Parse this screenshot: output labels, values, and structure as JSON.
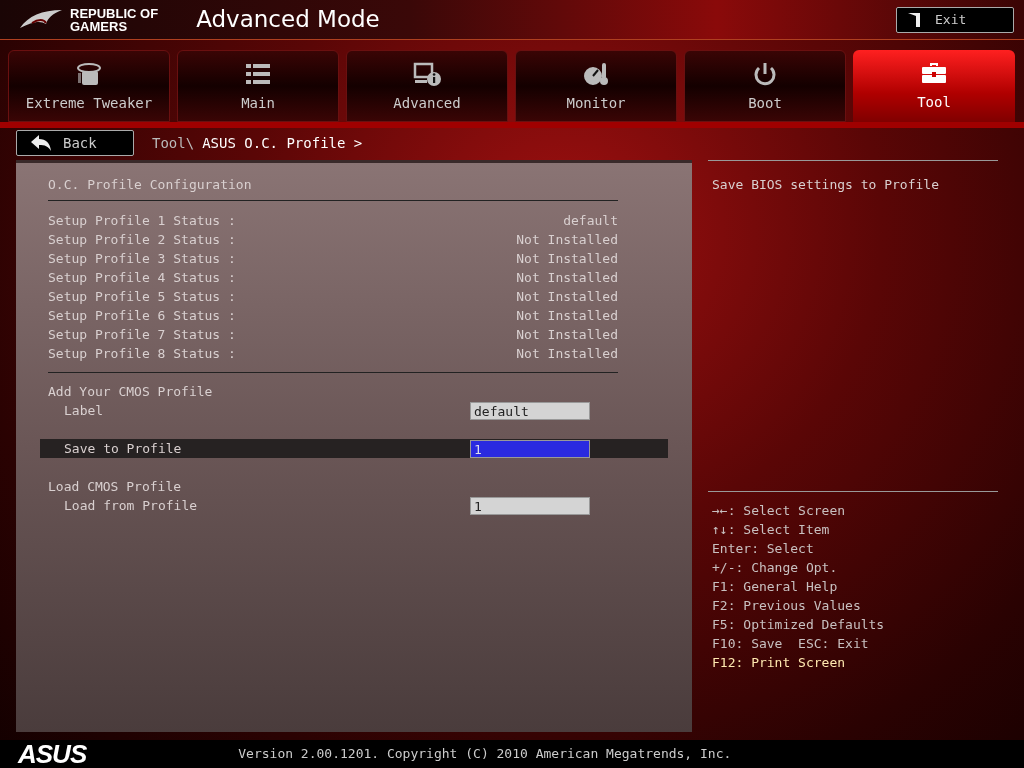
{
  "header": {
    "brand": [
      "REPUBLIC OF",
      "GAMERS"
    ],
    "title": "Advanced Mode",
    "exit_button": "Exit"
  },
  "tabs": [
    {
      "label": "Extreme Tweaker",
      "selected": false
    },
    {
      "label": "Main",
      "selected": false
    },
    {
      "label": "Advanced",
      "selected": false
    },
    {
      "label": "Monitor",
      "selected": false
    },
    {
      "label": "Boot",
      "selected": false
    },
    {
      "label": "Tool",
      "selected": true
    }
  ],
  "navigation": {
    "back_button": "Back",
    "breadcrumb_parent": "Tool\\",
    "breadcrumb_current": "ASUS O.C. Profile >"
  },
  "config": {
    "heading": "O.C. Profile Configuration",
    "profiles": [
      {
        "label": "Setup Profile 1 Status :",
        "value": "default"
      },
      {
        "label": "Setup Profile 2 Status :",
        "value": "Not Installed"
      },
      {
        "label": "Setup Profile 3 Status :",
        "value": "Not Installed"
      },
      {
        "label": "Setup Profile 4 Status :",
        "value": "Not Installed"
      },
      {
        "label": "Setup Profile 5 Status :",
        "value": "Not Installed"
      },
      {
        "label": "Setup Profile 6 Status :",
        "value": "Not Installed"
      },
      {
        "label": "Setup Profile 7 Status :",
        "value": "Not Installed"
      },
      {
        "label": "Setup Profile 8 Status :",
        "value": "Not Installed"
      }
    ]
  },
  "add_profile": {
    "heading": "Add Your CMOS Profile",
    "items": [
      {
        "label": "Label",
        "value": "default",
        "selected": false
      },
      {
        "label": "Save to Profile",
        "value": "1",
        "selected": true
      }
    ]
  },
  "load_profile": {
    "heading": "Load CMOS Profile",
    "items": [
      {
        "label": "Load from Profile",
        "value": "1",
        "selected": false
      }
    ]
  },
  "help": {
    "description": "Save BIOS settings to Profile",
    "keys": [
      {
        "text": "→←: Select Screen",
        "highlighted": false
      },
      {
        "text": "↑↓: Select Item",
        "highlighted": false
      },
      {
        "text": "Enter: Select",
        "highlighted": false
      },
      {
        "text": "+/-: Change Opt.",
        "highlighted": false
      },
      {
        "text": "F1: General Help",
        "highlighted": false
      },
      {
        "text": "F2: Previous Values",
        "highlighted": false
      },
      {
        "text": "F5: Optimized Defaults",
        "highlighted": false
      },
      {
        "text": "F10: Save  ESC: Exit",
        "highlighted": false
      },
      {
        "text": "F12: Print Screen",
        "highlighted": true
      }
    ]
  },
  "footer": {
    "logo": "ASUS",
    "version": "Version 2.00.1201. Copyright (C) 2010 American Megatrends, Inc."
  }
}
